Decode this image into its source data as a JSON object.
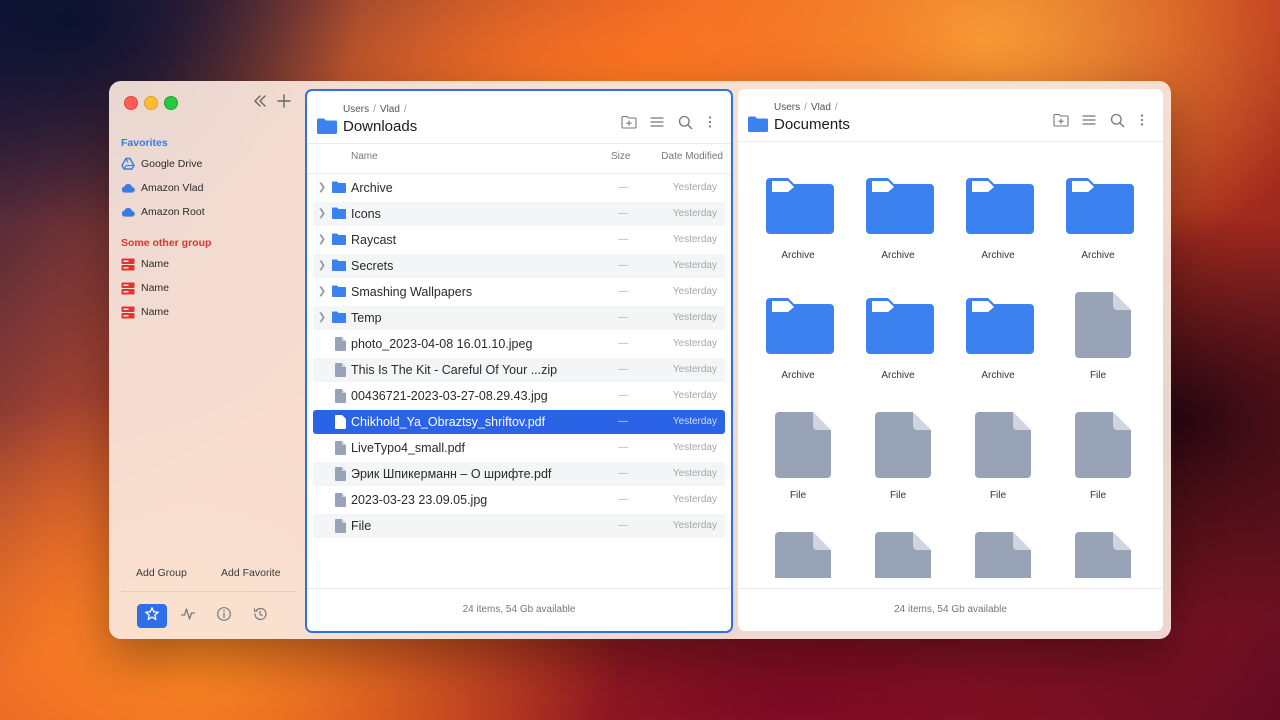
{
  "sidebar": {
    "favorites_title": "Favorites",
    "favorites": [
      {
        "label": "Google Drive",
        "icon": "google-drive-icon"
      },
      {
        "label": "Amazon Vlad",
        "icon": "cloud-icon"
      },
      {
        "label": "Amazon Root",
        "icon": "cloud-icon"
      }
    ],
    "group_title": "Some other group",
    "group_items": [
      {
        "label": "Name",
        "icon": "server-icon"
      },
      {
        "label": "Name",
        "icon": "server-icon"
      },
      {
        "label": "Name",
        "icon": "server-icon"
      }
    ],
    "add_group": "Add Group",
    "add_favorite": "Add Favorite",
    "tabs": [
      "star-icon",
      "activity-icon",
      "info-icon",
      "history-icon"
    ],
    "active_tab": 0
  },
  "colors": {
    "accent": "#2f6fe8",
    "favorites_title": "#3a7be8",
    "group_title": "#e0342f",
    "folder": "#3b82f0",
    "file": "#98a3b8"
  },
  "left_panel": {
    "breadcrumb": [
      "Users",
      "Vlad"
    ],
    "title": "Downloads",
    "columns": {
      "name": "Name",
      "size": "Size",
      "date": "Date Modified"
    },
    "rows": [
      {
        "name": "Archive",
        "type": "folder",
        "size": "—",
        "date": "Yesterday"
      },
      {
        "name": "Icons",
        "type": "folder",
        "size": "—",
        "date": "Yesterday"
      },
      {
        "name": "Raycast",
        "type": "folder",
        "size": "—",
        "date": "Yesterday"
      },
      {
        "name": "Secrets",
        "type": "folder",
        "size": "—",
        "date": "Yesterday"
      },
      {
        "name": "Smashing Wallpapers",
        "type": "folder",
        "size": "—",
        "date": "Yesterday"
      },
      {
        "name": "Temp",
        "type": "folder",
        "size": "—",
        "date": "Yesterday"
      },
      {
        "name": "photo_2023-04-08 16.01.10.jpeg",
        "type": "file",
        "size": "—",
        "date": "Yesterday"
      },
      {
        "name": "This Is The Kit - Careful Of Your ...zip",
        "type": "file",
        "size": "—",
        "date": "Yesterday"
      },
      {
        "name": "00436721-2023-03-27-08.29.43.jpg",
        "type": "file",
        "size": "—",
        "date": "Yesterday"
      },
      {
        "name": "Chikhold_Ya_Obraztsy_shriftov.pdf",
        "type": "file",
        "size": "—",
        "date": "Yesterday"
      },
      {
        "name": "LiveTypo4_small.pdf",
        "type": "file",
        "size": "—",
        "date": "Yesterday"
      },
      {
        "name": "Эрик Шпикерманн – О шрифте.pdf",
        "type": "file",
        "size": "—",
        "date": "Yesterday"
      },
      {
        "name": "2023-03-23 23.09.05.jpg",
        "type": "file",
        "size": "—",
        "date": "Yesterday"
      },
      {
        "name": "File",
        "type": "file",
        "size": "—",
        "date": "Yesterday"
      }
    ],
    "selected_row": 9,
    "status": "24 items, 54 Gb available"
  },
  "right_panel": {
    "breadcrumb": [
      "Users",
      "Vlad"
    ],
    "title": "Documents",
    "items": [
      {
        "label": "Archive",
        "type": "folder"
      },
      {
        "label": "Archive",
        "type": "folder"
      },
      {
        "label": "Archive",
        "type": "folder"
      },
      {
        "label": "Archive",
        "type": "folder"
      },
      {
        "label": "Archive",
        "type": "folder"
      },
      {
        "label": "Archive",
        "type": "folder"
      },
      {
        "label": "Archive",
        "type": "folder"
      },
      {
        "label": "File",
        "type": "file"
      },
      {
        "label": "File",
        "type": "file"
      },
      {
        "label": "File",
        "type": "file"
      },
      {
        "label": "File",
        "type": "file"
      },
      {
        "label": "File",
        "type": "file"
      },
      {
        "label": "",
        "type": "file"
      },
      {
        "label": "",
        "type": "file"
      },
      {
        "label": "",
        "type": "file"
      },
      {
        "label": "",
        "type": "file"
      }
    ],
    "status": "24 items, 54 Gb available"
  }
}
